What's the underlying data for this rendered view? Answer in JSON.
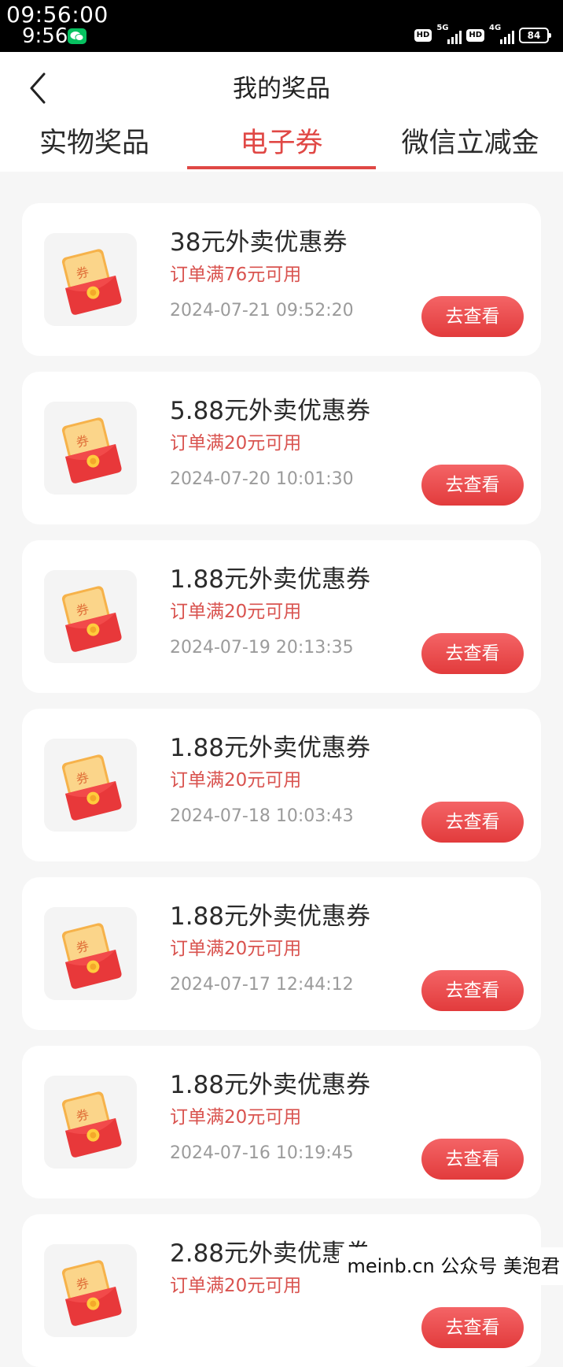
{
  "status_bar": {
    "time_top": "09:56:00",
    "time": "9:56",
    "hd1": "HD",
    "net1": "5G",
    "hd2": "HD",
    "net2": "4G",
    "battery": "84"
  },
  "header": {
    "title": "我的奖品",
    "back_icon": "chevron-left-icon"
  },
  "tabs": [
    {
      "label": "实物奖品",
      "active": false
    },
    {
      "label": "电子券",
      "active": true
    },
    {
      "label": "微信立减金",
      "active": false
    }
  ],
  "coupons": [
    {
      "title": "38元外卖优惠券",
      "condition": "订单满76元可用",
      "time": "2024-07-21 09:52:20",
      "button": "去查看"
    },
    {
      "title": "5.88元外卖优惠券",
      "condition": "订单满20元可用",
      "time": "2024-07-20 10:01:30",
      "button": "去查看"
    },
    {
      "title": "1.88元外卖优惠券",
      "condition": "订单满20元可用",
      "time": "2024-07-19 20:13:35",
      "button": "去查看"
    },
    {
      "title": "1.88元外卖优惠券",
      "condition": "订单满20元可用",
      "time": "2024-07-18 10:03:43",
      "button": "去查看"
    },
    {
      "title": "1.88元外卖优惠券",
      "condition": "订单满20元可用",
      "time": "2024-07-17 12:44:12",
      "button": "去查看"
    },
    {
      "title": "1.88元外卖优惠券",
      "condition": "订单满20元可用",
      "time": "2024-07-16 10:19:45",
      "button": "去查看"
    },
    {
      "title": "2.88元外卖优惠券",
      "condition": "订单满20元可用",
      "time": "",
      "button": "去查看"
    }
  ],
  "coupon_icon_text": "券",
  "watermark": "meinb.cn  公众号 美泡君",
  "colors": {
    "accent": "#e04845",
    "button": "#e8403f",
    "page_bg": "#f6f6f6"
  }
}
